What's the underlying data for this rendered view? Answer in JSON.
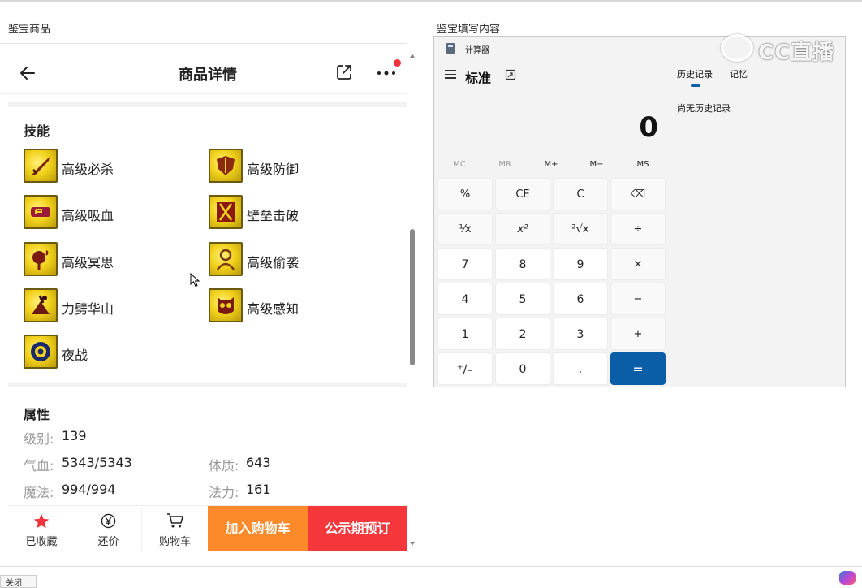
{
  "left_panel": {
    "title": "鉴宝商品"
  },
  "right_panel": {
    "title": "鉴宝填写内容"
  },
  "nav": {
    "title": "商品详情"
  },
  "skills": {
    "title": "技能",
    "items": [
      {
        "name": "高级必杀",
        "icon": "sword-icon"
      },
      {
        "name": "高级防御",
        "icon": "shield-icon"
      },
      {
        "name": "高级吸血",
        "icon": "blood-icon"
      },
      {
        "name": "壁垒击破",
        "icon": "breaker-icon"
      },
      {
        "name": "高级冥思",
        "icon": "meditation-icon"
      },
      {
        "name": "高级偷袭",
        "icon": "sneak-icon"
      },
      {
        "name": "力劈华山",
        "icon": "cleave-icon"
      },
      {
        "name": "高级感知",
        "icon": "owl-icon"
      },
      {
        "name": "夜战",
        "icon": "eye-icon"
      }
    ]
  },
  "attributes": {
    "title": "属性",
    "level": {
      "label": "级别:",
      "value": "139"
    },
    "hp": {
      "label": "气血:",
      "value": "5343/5343"
    },
    "constitution": {
      "label": "体质:",
      "value": "643"
    },
    "mp": {
      "label": "魔法:",
      "value": "994/994"
    },
    "magic": {
      "label": "法力:",
      "value": "161"
    }
  },
  "bottom_bar": {
    "favorite": "已收藏",
    "bargain": "还价",
    "cart": "购物车",
    "add_to_cart": "加入购物车",
    "reserve": "公示期预订"
  },
  "calculator": {
    "app_title": "计算器",
    "mode": "标准",
    "display": "0",
    "memory_keys": [
      "MC",
      "MR",
      "M+",
      "M−",
      "MS"
    ],
    "keys": [
      [
        "%",
        "CE",
        "C",
        "⌫"
      ],
      [
        "¹⁄x",
        "x²",
        "²√x",
        "÷"
      ],
      [
        "7",
        "8",
        "9",
        "×"
      ],
      [
        "4",
        "5",
        "6",
        "−"
      ],
      [
        "1",
        "2",
        "3",
        "+"
      ],
      [
        "⁺∕₋",
        "0",
        ".",
        "="
      ]
    ],
    "history_tab": "历史记录",
    "memory_tab": "记忆",
    "history_empty": "尚无历史记录"
  },
  "watermark": {
    "text": "CC直播"
  },
  "footer": {
    "close": "关闭"
  },
  "colors": {
    "accent_orange": "#fd8a2a",
    "accent_red": "#f5363b",
    "calc_equals": "#0a5ea8"
  }
}
